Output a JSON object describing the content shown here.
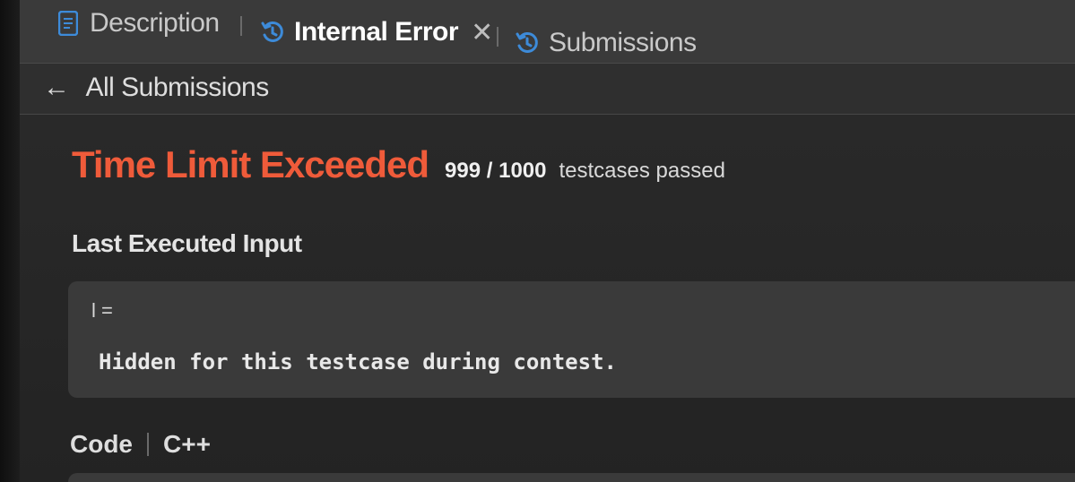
{
  "tabs": {
    "description_label": "Description",
    "internal_error_label": "Internal Error",
    "close_label": "✕",
    "submissions_label": "Submissions"
  },
  "subheader": {
    "back_label": "All Submissions"
  },
  "result": {
    "status": "Time Limit Exceeded",
    "passed_count": "999 / 1000",
    "passed_label": "testcases passed"
  },
  "last_input": {
    "title": "Last Executed Input",
    "variable": "l =",
    "value": "Hidden for this testcase during contest."
  },
  "code": {
    "label": "Code",
    "language": "C++"
  },
  "colors": {
    "accent_error": "#ef5b3a",
    "icon_blue": "#3d8bd9"
  }
}
